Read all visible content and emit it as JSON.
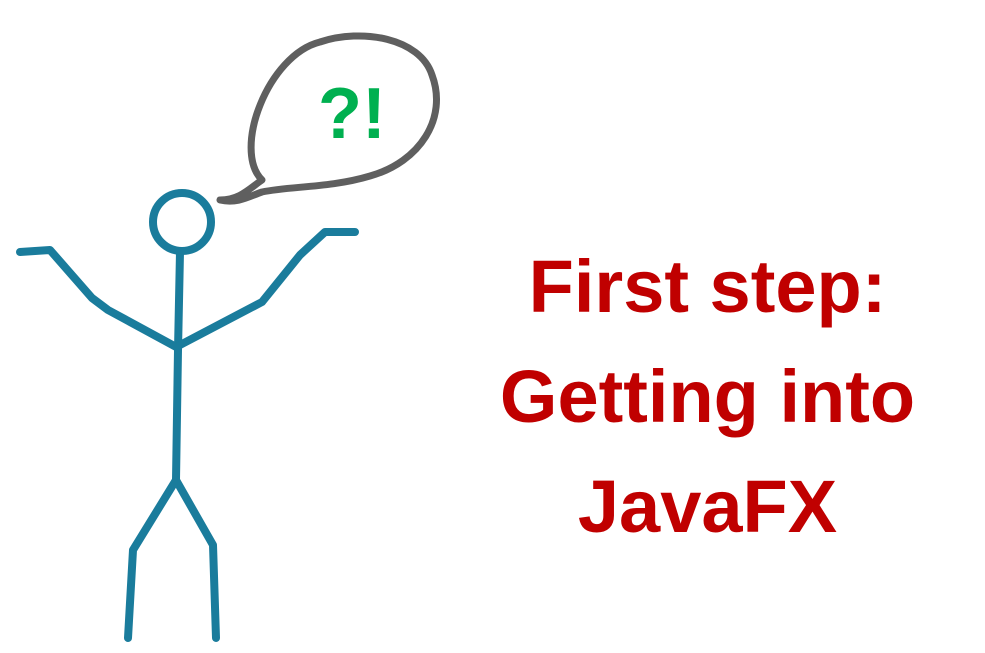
{
  "speech_bubble": {
    "text": "?!"
  },
  "headline": {
    "lines": [
      "First step:",
      "Getting into",
      "JavaFX"
    ]
  },
  "colors": {
    "stick_figure": "#1a7c9c",
    "bubble_outline": "#5f5f5f",
    "bubble_text": "#00b050",
    "headline": "#c00000",
    "background": "#ffffff"
  }
}
